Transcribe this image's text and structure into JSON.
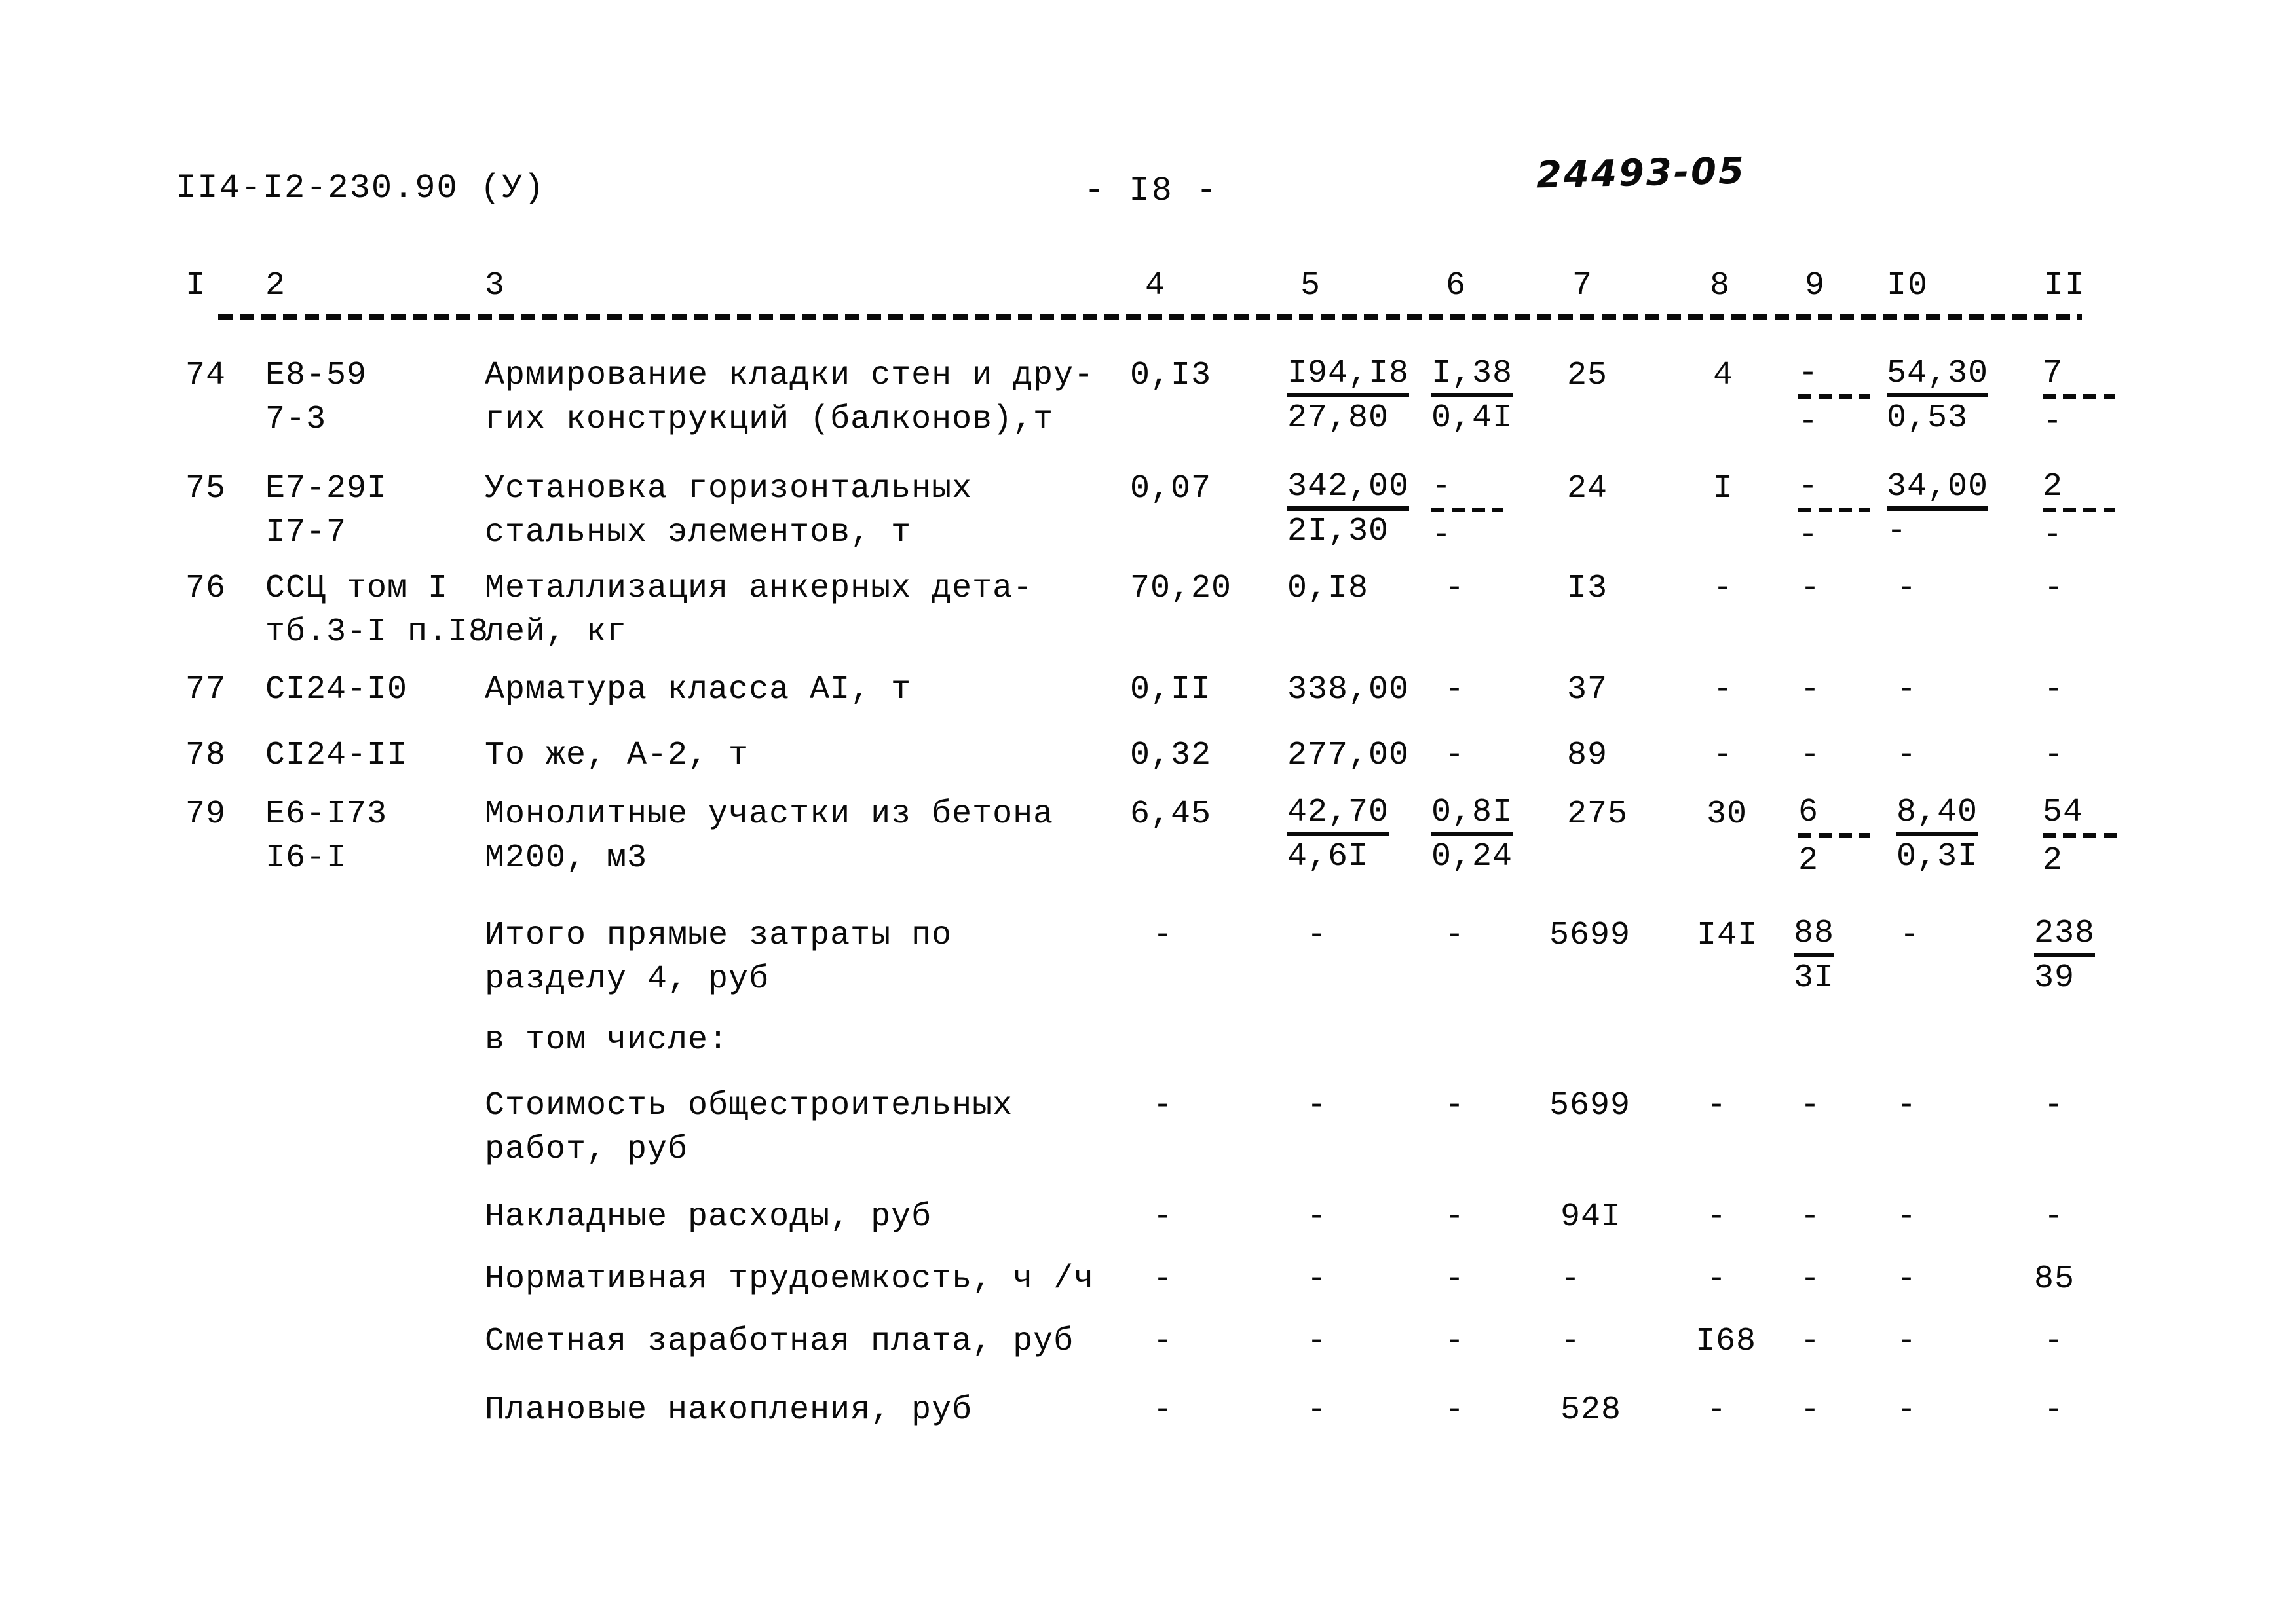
{
  "header": {
    "doc_code": "II4-I2-230.90 (У)",
    "page_marker": "- I8 -",
    "handwritten_note": "24493-05"
  },
  "table": {
    "column_headers": [
      "I",
      "2",
      "3",
      "4",
      "5",
      "6",
      "7",
      "8",
      "9",
      "I0",
      "II"
    ],
    "rows": [
      {
        "num": "74",
        "code_line1": "Е8-59",
        "code_line2": "7-3",
        "desc_line1": "Армирование кладки стен и дру-",
        "desc_line2": "гих конструкций (балконов),т",
        "c4": "0,I3",
        "c5_top": "I94,I8",
        "c5_bot": "27,80",
        "c6_top": "I,38",
        "c6_bot": "0,4I",
        "c7": "25",
        "c8": "4",
        "c9_top": "-",
        "c9_bot": "-",
        "c10_top": "54,30",
        "c10_bot": "0,53",
        "c11_top": "7",
        "c11_bot": "-"
      },
      {
        "num": "75",
        "code_line1": "Е7-29I",
        "code_line2": "I7-7",
        "desc_line1": "Установка горизонтальных",
        "desc_line2": "стальных элементов, т",
        "c4": "0,07",
        "c5_top": "342,00",
        "c5_bot": "2I,30",
        "c6_top": "-",
        "c6_bot": "-",
        "c7": "24",
        "c8": "I",
        "c9_top": "-",
        "c9_bot": "-",
        "c10_top": "34,00",
        "c10_bot": "-",
        "c11_top": "2",
        "c11_bot": "-"
      },
      {
        "num": "76",
        "code_line1": "ССЦ том I",
        "code_line2": "тб.3-I п.I8",
        "desc_line1": "Металлизация анкерных дета-",
        "desc_line2": "лей, кг",
        "c4": "70,20",
        "c5": "0,I8",
        "c6": "-",
        "c7": "I3",
        "c8": "-",
        "c9": "-",
        "c10": "-",
        "c11": "-"
      },
      {
        "num": "77",
        "code_line1": "СI24-I0",
        "code_line2": "",
        "desc_line1": "Арматура класса АI, т",
        "desc_line2": "",
        "c4": "0,II",
        "c5": "338,00",
        "c6": "-",
        "c7": "37",
        "c8": "-",
        "c9": "-",
        "c10": "-",
        "c11": "-"
      },
      {
        "num": "78",
        "code_line1": "СI24-II",
        "code_line2": "",
        "desc_line1": "То же, А-2, т",
        "desc_line2": "",
        "c4": "0,32",
        "c5": "277,00",
        "c6": "-",
        "c7": "89",
        "c8": "-",
        "c9": "-",
        "c10": "-",
        "c11": "-"
      },
      {
        "num": "79",
        "code_line1": "Е6-I73",
        "code_line2": "I6-I",
        "desc_line1": "Монолитные участки из бетона",
        "desc_line2": "М200, м3",
        "c4": "6,45",
        "c5_top": "42,70",
        "c5_bot": "4,6I",
        "c6_top": "0,8I",
        "c6_bot": "0,24",
        "c7": "275",
        "c8": "30",
        "c9_top": "6",
        "c9_bot": "2",
        "c10_top": "8,40",
        "c10_bot": "0,3I",
        "c11_top": "54",
        "c11_bot": "2"
      }
    ],
    "summary_rows": [
      {
        "desc_line1": "Итого прямые затраты по",
        "desc_line2": "разделу 4, руб",
        "c4": "-",
        "c5": "-",
        "c6": "-",
        "c7": "5699",
        "c8": "I4I",
        "c9_top": "88",
        "c9_bot": "3I",
        "c10": "-",
        "c11_top": "238",
        "c11_bot": "39"
      },
      {
        "desc_line1": "в том числе:",
        "desc_line2": "",
        "c4": "",
        "c5": "",
        "c6": "",
        "c7": "",
        "c8": "",
        "c9": "",
        "c10": "",
        "c11": ""
      },
      {
        "desc_line1": "Стоимость общестроительных",
        "desc_line2": "работ, руб",
        "c4": "-",
        "c5": "-",
        "c6": "-",
        "c7": "5699",
        "c8": "-",
        "c9": "-",
        "c10": "-",
        "c11": "-"
      },
      {
        "desc_line1": "Накладные расходы, руб",
        "desc_line2": "",
        "c4": "-",
        "c5": "-",
        "c6": "-",
        "c7": "94I",
        "c8": "-",
        "c9": "-",
        "c10": "-",
        "c11": "-"
      },
      {
        "desc_line1": "Нормативная трудоемкость, ч /ч",
        "desc_line2": "",
        "c4": "-",
        "c5": "-",
        "c6": "-",
        "c7": "-",
        "c8": "-",
        "c9": "-",
        "c10": "-",
        "c11": "85"
      },
      {
        "desc_line1": "Сметная заработная плата, руб",
        "desc_line2": "",
        "c4": "-",
        "c5": "-",
        "c6": "-",
        "c7": "-",
        "c8": "I68",
        "c9": "-",
        "c10": "-",
        "c11": "-"
      },
      {
        "desc_line1": "Плановые накопления, руб",
        "desc_line2": "",
        "c4": "-",
        "c5": "-",
        "c6": "-",
        "c7": "528",
        "c8": "-",
        "c9": "-",
        "c10": "-",
        "c11": "-"
      }
    ]
  }
}
